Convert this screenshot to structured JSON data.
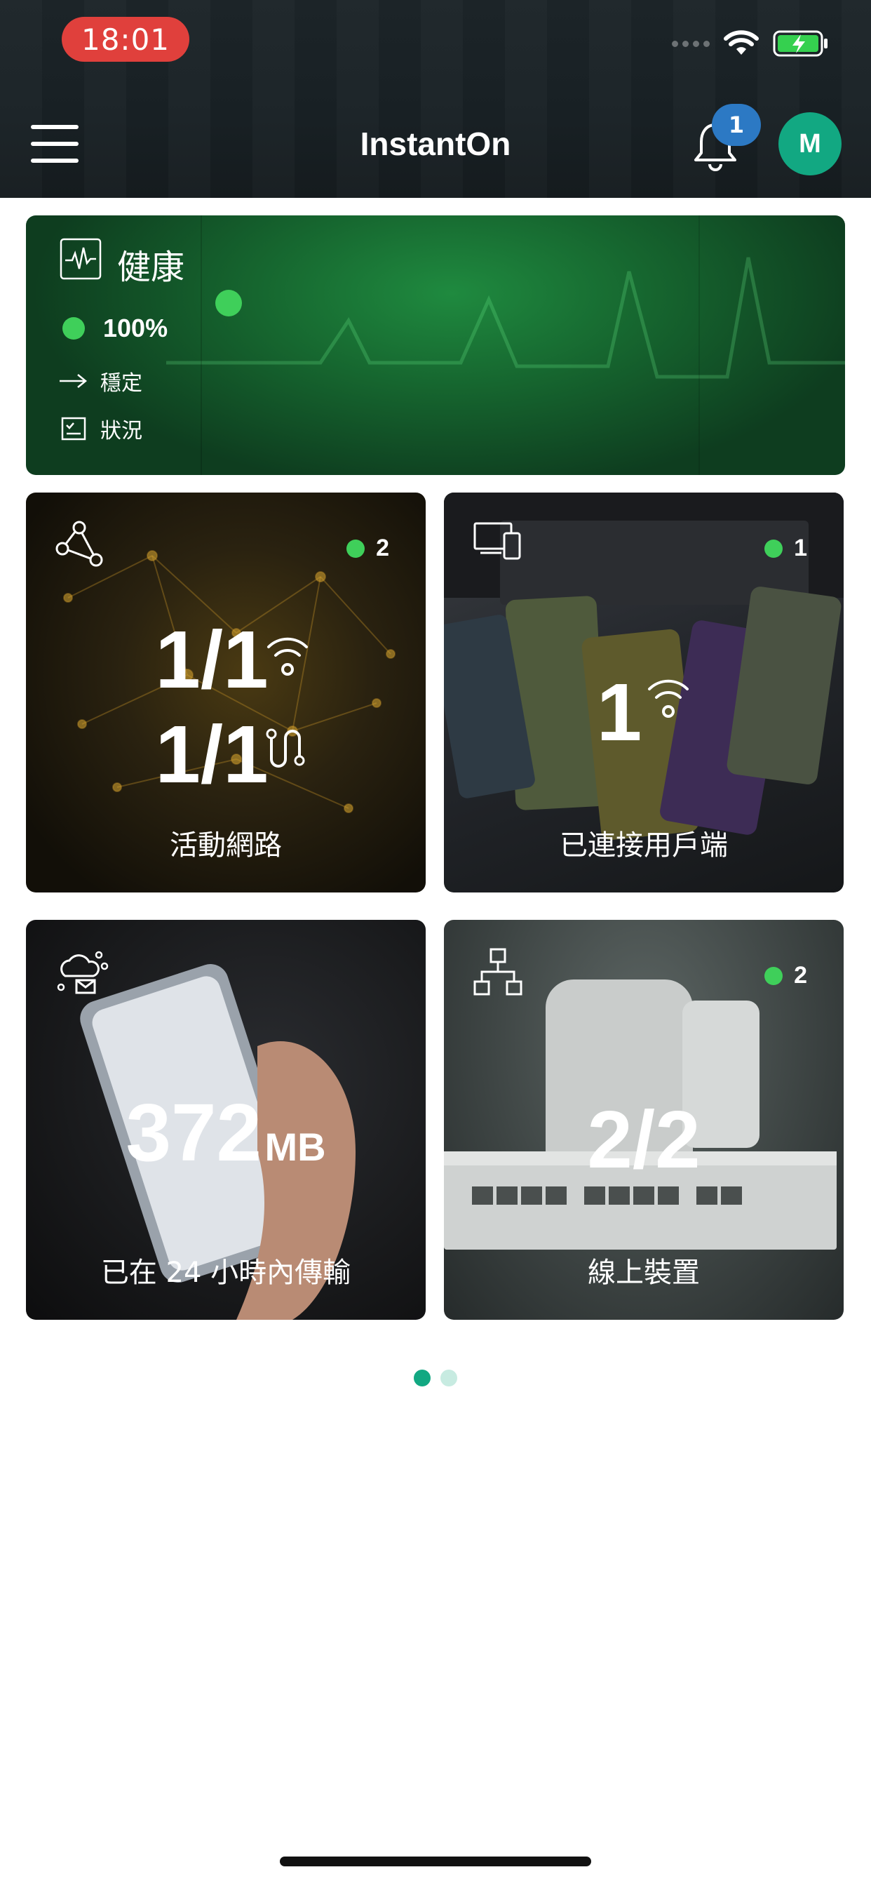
{
  "status_bar": {
    "time": "18:01"
  },
  "header": {
    "title": "InstantOn",
    "notification_count": "1",
    "avatar_initial": "M"
  },
  "health": {
    "title": "健康",
    "percent": "100%",
    "stable_label": "穩定",
    "status_label": "狀況"
  },
  "tiles": [
    {
      "id": "networks",
      "count": "2",
      "line1": "1/1",
      "line2": "1/1",
      "label": "活動網路"
    },
    {
      "id": "clients",
      "count": "1",
      "value": "1",
      "label": "已連接用戶端"
    },
    {
      "id": "traffic",
      "value": "372",
      "unit": "MB",
      "label": "已在 24 小時內傳輸"
    },
    {
      "id": "devices",
      "count": "2",
      "value": "2/2",
      "label": "線上裝置"
    }
  ],
  "pager": {
    "active_index": 0,
    "total": 2
  },
  "colors": {
    "accent": "#12a882",
    "status_green": "#3fcf5a",
    "badge_blue": "#2c79c4",
    "time_pill": "#e0403c"
  }
}
